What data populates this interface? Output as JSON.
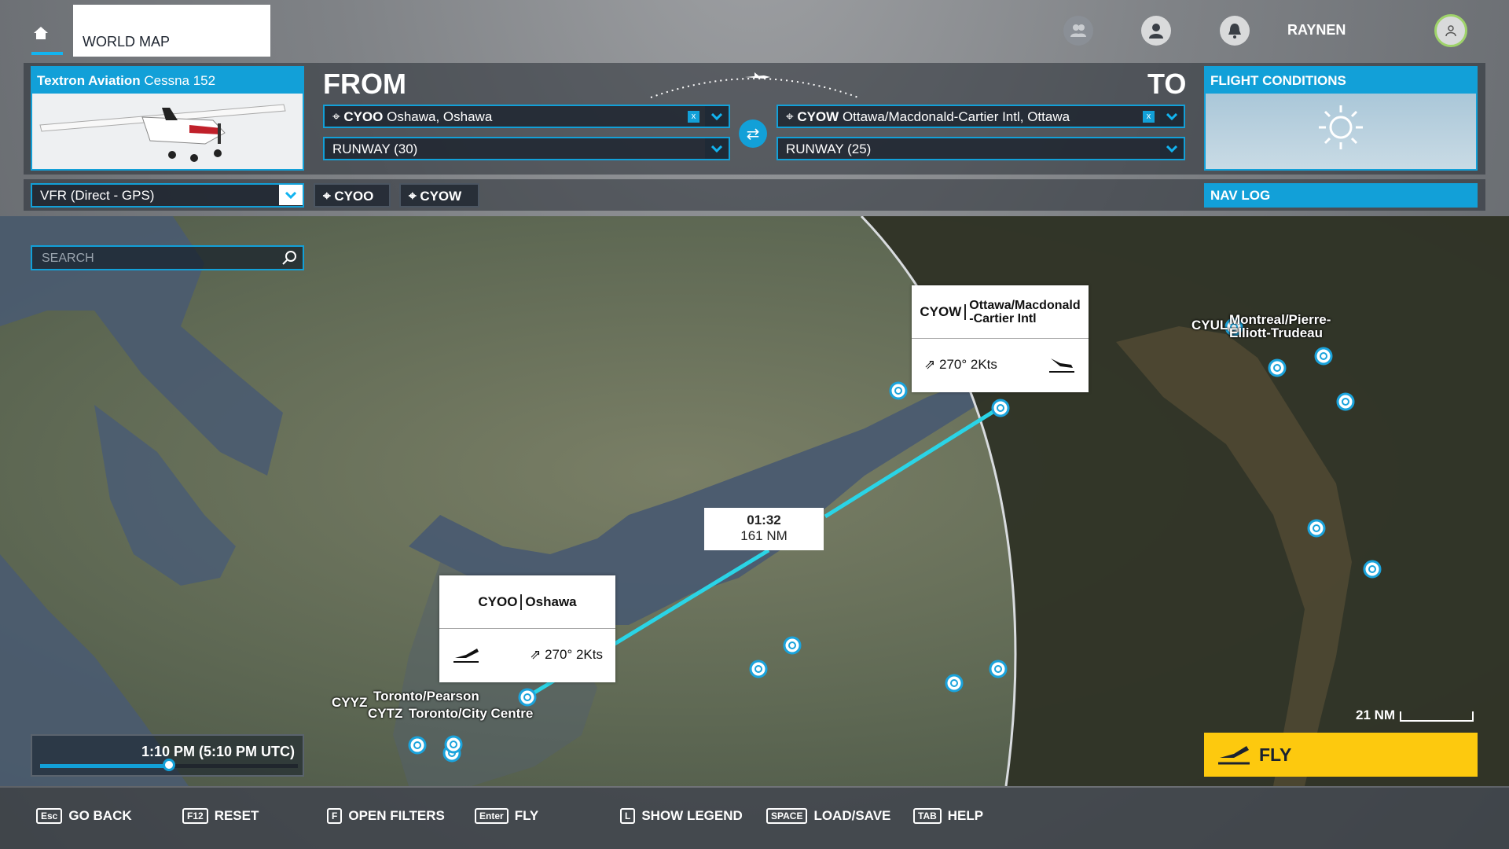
{
  "header": {
    "tab": "WORLD MAP",
    "username": "RAYNEN"
  },
  "aircraft": {
    "maker": "Textron Aviation",
    "model": "Cessna 152"
  },
  "route": {
    "from_label": "FROM",
    "to_label": "TO",
    "from_code": "CYOO",
    "from_name": "Oshawa, Oshawa",
    "to_code": "CYOW",
    "to_name": "Ottawa/Macdonald-Cartier Intl, Ottawa",
    "from_runway": "RUNWAY (30)",
    "to_runway": "RUNWAY (25)",
    "clear_glyph": "x"
  },
  "flight_conditions": {
    "title": "FLIGHT CONDITIONS",
    "weather_icon": "sun-icon"
  },
  "flight_plan": {
    "type": "VFR (Direct - GPS)",
    "waypoints": [
      "CYOO",
      "CYOW"
    ]
  },
  "nav_log": "NAV LOG",
  "search": {
    "placeholder": "SEARCH"
  },
  "map": {
    "origin": {
      "code": "CYOO",
      "name": "Oshawa",
      "wind": "270° 2Kts"
    },
    "destination": {
      "code": "CYOW",
      "name": "Ottawa/Macdonald\n-Cartier Intl",
      "wind": "270° 2Kts"
    },
    "leg": {
      "time": "01:32",
      "distance": "161 NM"
    },
    "labels": {
      "cyyz_code": "CYYZ",
      "cyyz_name": "Toronto/Pearson",
      "cytz_name": "Toronto/City Centre",
      "cytz_code": "CYTZ",
      "cyul_code": "CYUL",
      "cyul_name": "Montreal/Pierre-\nElliott-Trudeau"
    },
    "scale": "21 NM",
    "time": "1:10 PM (5:10 PM UTC)",
    "time_slider_fraction": 0.5,
    "route_color": "#2ad4e6"
  },
  "fly_button": "FLY",
  "bottom_bar": [
    {
      "key": "Esc",
      "label": "GO BACK"
    },
    {
      "key": "F12",
      "label": "RESET"
    },
    {
      "key": "F",
      "label": "OPEN FILTERS"
    },
    {
      "key": "Enter",
      "label": "FLY"
    },
    {
      "key": "L",
      "label": "SHOW LEGEND"
    },
    {
      "key": "SPACE",
      "label": "LOAD/SAVE"
    },
    {
      "key": "TAB",
      "label": "HELP"
    }
  ]
}
